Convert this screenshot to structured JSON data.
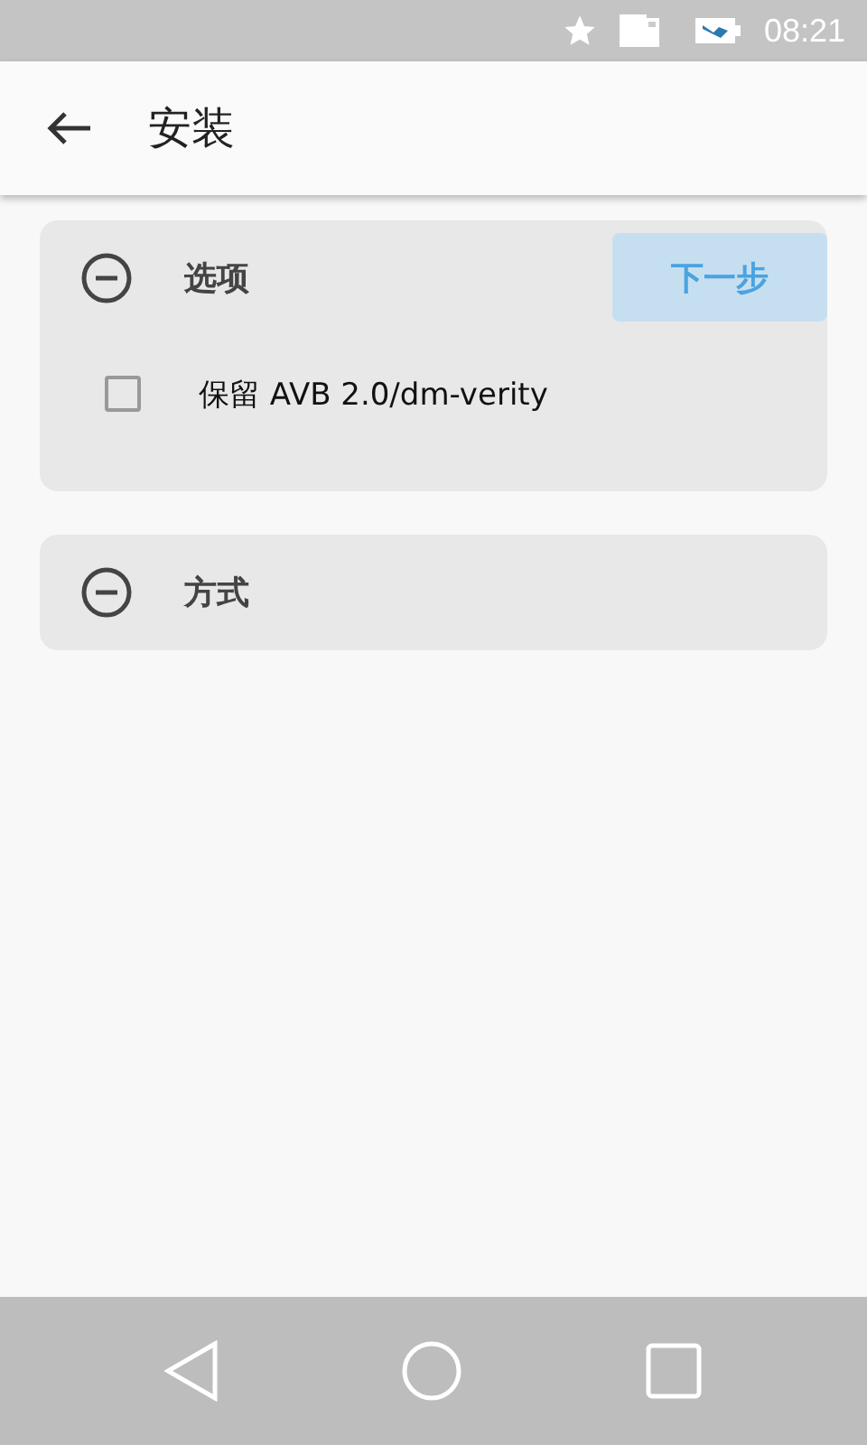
{
  "status_bar": {
    "time": "08:21"
  },
  "app_bar": {
    "title": "安装"
  },
  "sections": [
    {
      "title": "选项",
      "next_button": "下一步",
      "options": [
        {
          "label": "保留 AVB 2.0/dm-verity",
          "checked": false
        }
      ]
    },
    {
      "title": "方式"
    }
  ]
}
